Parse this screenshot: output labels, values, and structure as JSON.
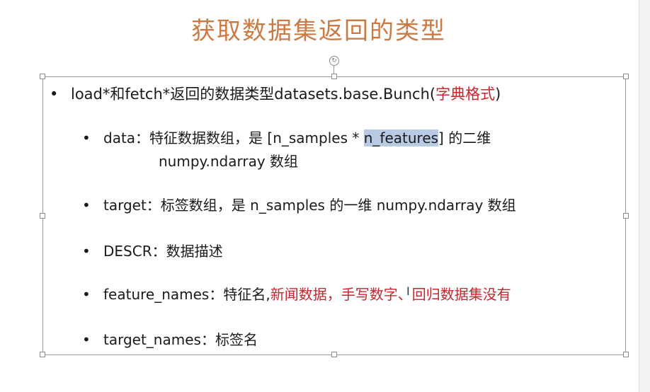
{
  "slide": {
    "title": "获取数据集返回的类型",
    "bullets": {
      "main": {
        "text": "load*和fetch*返回的数据类型datasets.base.Bunch(",
        "red": "字典格式",
        "after": ")"
      },
      "data": {
        "text": "data：特征数据数组，是 [n_samples * ",
        "selected": "n_features",
        "after": "] 的二维",
        "cont": "numpy.ndarray 数组"
      },
      "target": {
        "text": "target：标签数组，是 n_samples 的一维 numpy.ndarray 数组"
      },
      "descr": {
        "text": "DESCR：数据描述"
      },
      "feature_names": {
        "text": "feature_names：特征名,",
        "red": "新闻数据，手写数字、回归数据集没有"
      },
      "target_names": {
        "text": "target_names：标签名"
      }
    }
  }
}
